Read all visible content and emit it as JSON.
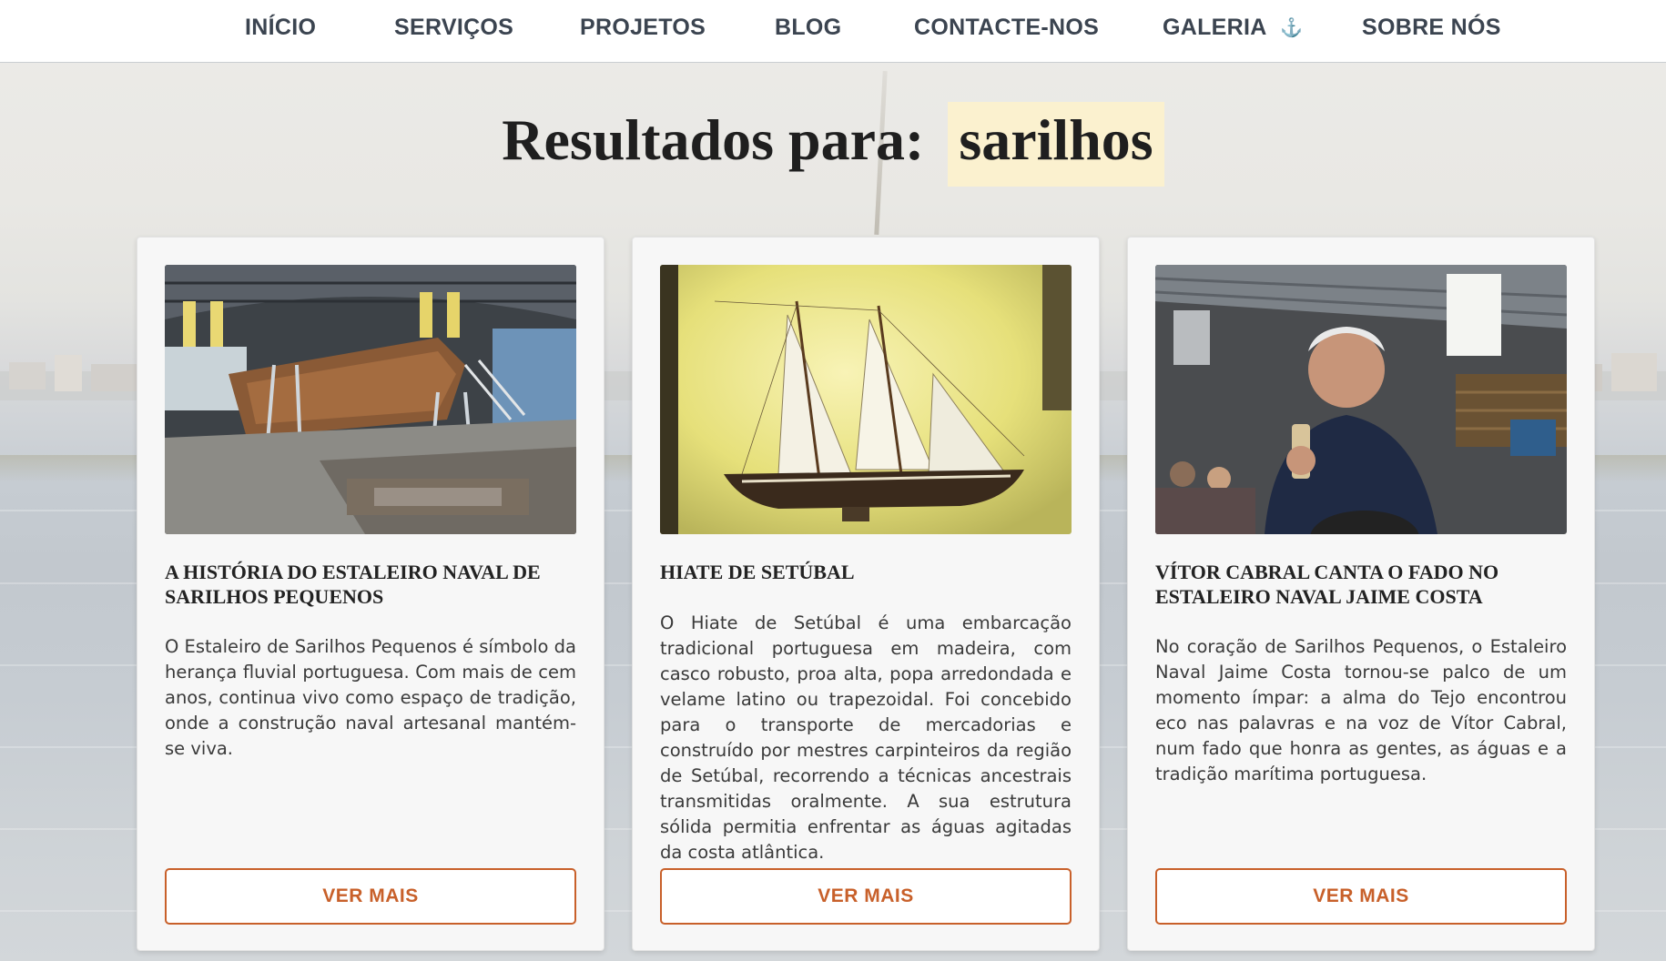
{
  "nav": {
    "items": [
      {
        "label": "INÍCIO"
      },
      {
        "label": "SERVIÇOS"
      },
      {
        "label": "PROJETOS"
      },
      {
        "label": "BLOG"
      },
      {
        "label": "CONTACTE-NOS"
      },
      {
        "label": "GALERIA",
        "icon": "anchor-icon"
      },
      {
        "label": "SOBRE NÓS"
      }
    ]
  },
  "search": {
    "heading_prefix": "Resultados para:",
    "query": "sarilhos"
  },
  "results": [
    {
      "title": "A HISTÓRIA DO ESTALEIRO NAVAL DE SARILHOS PEQUENOS",
      "excerpt": "O Estaleiro de Sarilhos Pequenos é símbolo da herança fluvial portuguesa. Com mais de cem anos, continua vivo como espaço de tradição, onde a construção naval artesanal mantém-se viva.",
      "image": "boatyard-shed-photo",
      "button": "VER MAIS"
    },
    {
      "title": "HIATE DE SETÚBAL",
      "excerpt": "O Hiate de Setúbal é uma embarcação tradicional portuguesa em madeira, com casco robusto, proa alta, popa arredondada e velame latino ou trapezoidal. Foi concebido para o transporte de mercadorias e construído por mestres carpinteiros da região de Setúbal, recorrendo a técnicas ancestrais transmitidas oralmente. A sua estrutura sólida permitia enfrentar as águas agitadas da costa atlântica.",
      "image": "model-ship-photo",
      "button": "VER MAIS"
    },
    {
      "title": "VÍTOR CABRAL CANTA O FADO NO ESTALEIRO NAVAL JAIME COSTA",
      "excerpt": "No coração de Sarilhos Pequenos, o Estaleiro Naval Jaime Costa tornou-se palco de um momento ímpar: a alma do Tejo encontrou eco nas palavras e na voz de Vítor Cabral, num fado que honra as gentes, as águas e a tradição marítima portuguesa.",
      "image": "fado-singer-photo",
      "button": "VER MAIS"
    }
  ],
  "colors": {
    "accent": "#c8602a",
    "nav_text": "#3b4450",
    "query_highlight": "#fbf1cf",
    "anchor_icon": "#3a8fd0"
  }
}
